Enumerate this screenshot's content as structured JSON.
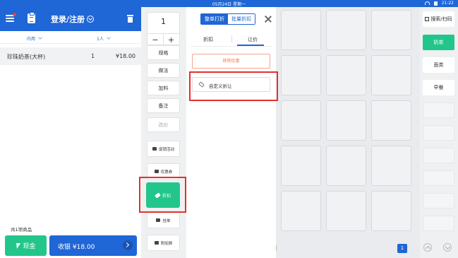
{
  "statusbar": {
    "date": "05月24日 星期一",
    "time": "21:22"
  },
  "header": {
    "login_label": "登录/注册"
  },
  "order": {
    "dine_mode": "内用",
    "people": "1人",
    "items": [
      {
        "name": "珍珠奶茶(大杯)",
        "qty": "1",
        "price": "¥18.00"
      }
    ],
    "item_count": "共1项商品"
  },
  "payment": {
    "cash_label": "现金",
    "checkout_label": "收银 ¥18.00"
  },
  "actions": {
    "quantity": "1",
    "minus": "−",
    "plus": "+",
    "spec": "规格",
    "method": "做法",
    "addon": "加料",
    "note": "备注",
    "change_price": "改价",
    "promotion": "促销活动",
    "coupon": "优惠券",
    "discount": "折扣",
    "hold": "挂单",
    "surcharge": "附加费"
  },
  "discount_panel": {
    "mode_whole": "整单打折",
    "mode_batch": "批量折扣",
    "tab_discount": "折扣",
    "tab_reduce": "让价",
    "remove_label": "移除优惠",
    "custom_label": "自定义折让"
  },
  "grid": {
    "page": "1"
  },
  "categories": {
    "search_scan": "搜索/扫码",
    "items": [
      "奶茶",
      "面类",
      "早餐"
    ]
  },
  "colors": {
    "primary": "#1f66d6",
    "green": "#22c68b",
    "highlight": "#e3312d"
  }
}
